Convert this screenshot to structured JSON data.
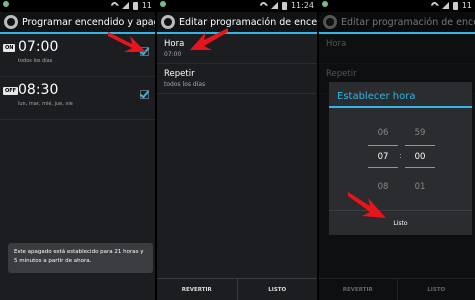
{
  "status": {
    "p1_time": "11",
    "p2_time": "11:24",
    "p3_time": "11"
  },
  "panel1": {
    "title": "Programar encendido y apagado",
    "schedules": [
      {
        "badge": "ON",
        "time": "07:00",
        "days": "todos los días",
        "checked": true
      },
      {
        "badge": "OFF",
        "time": "08:30",
        "days": "lun, mar, mié, jue, vie",
        "checked": true
      }
    ],
    "toast": "Este apagado está establecido para 21 horas y 5 minutos a partir de ahora."
  },
  "panel2": {
    "title": "Editar programación de encendido",
    "hora_label": "Hora",
    "hora_value": "07:00",
    "repetir_label": "Repetir",
    "repetir_value": "todos los días",
    "revert_button": "REVERTIR",
    "done_button": "LISTO"
  },
  "panel3": {
    "title": "Editar programación de encendido",
    "hora_label": "Hora",
    "repetir_label": "Repetir",
    "revert_button": "REVERTIR",
    "done_button": "LISTO",
    "dialog": {
      "title": "Establecer hora",
      "hours": [
        "06",
        "07",
        "08"
      ],
      "minutes": [
        "59",
        "00",
        "01"
      ],
      "separator": ":",
      "done_button": "Listo"
    }
  },
  "colors": {
    "accent": "#33b5e5",
    "arrow": "#e8141b"
  },
  "icons": {
    "settings": "gear-icon",
    "check": "checkbox-checked-icon",
    "pointer": "red-arrow-icon"
  }
}
